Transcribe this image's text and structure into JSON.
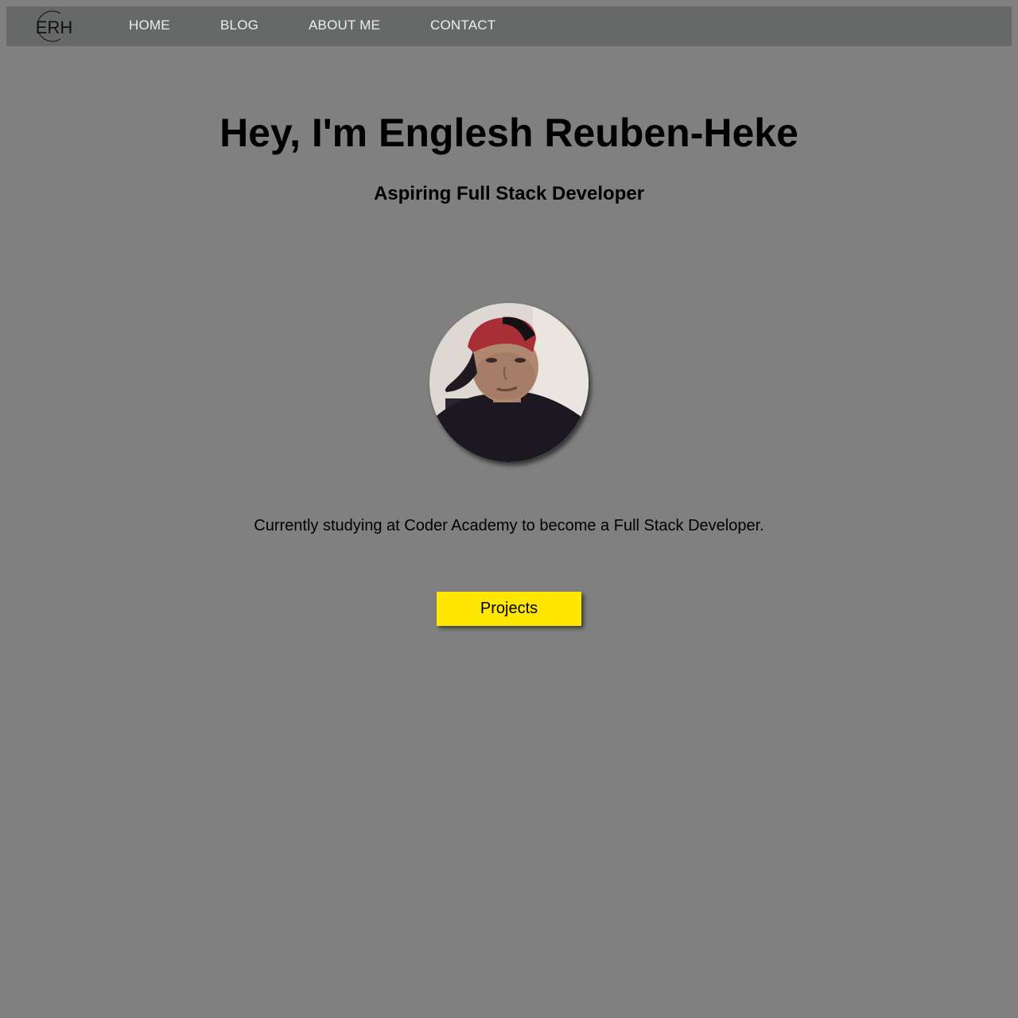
{
  "nav": {
    "logo_text": "ERH",
    "items": [
      {
        "label": "HOME"
      },
      {
        "label": "BLOG"
      },
      {
        "label": "ABOUT ME"
      },
      {
        "label": "CONTACT"
      }
    ]
  },
  "hero": {
    "title": "Hey, I'm Englesh Reuben-Heke",
    "subtitle": "Aspiring Full Stack Developer"
  },
  "bio": {
    "text": "Currently studying at Coder Academy to become a Full Stack Developer."
  },
  "cta": {
    "label": "Projects"
  },
  "colors": {
    "page_background": "#808080",
    "navbar_background": "#666968",
    "nav_text": "#ededed",
    "button_background": "#ffe600"
  }
}
